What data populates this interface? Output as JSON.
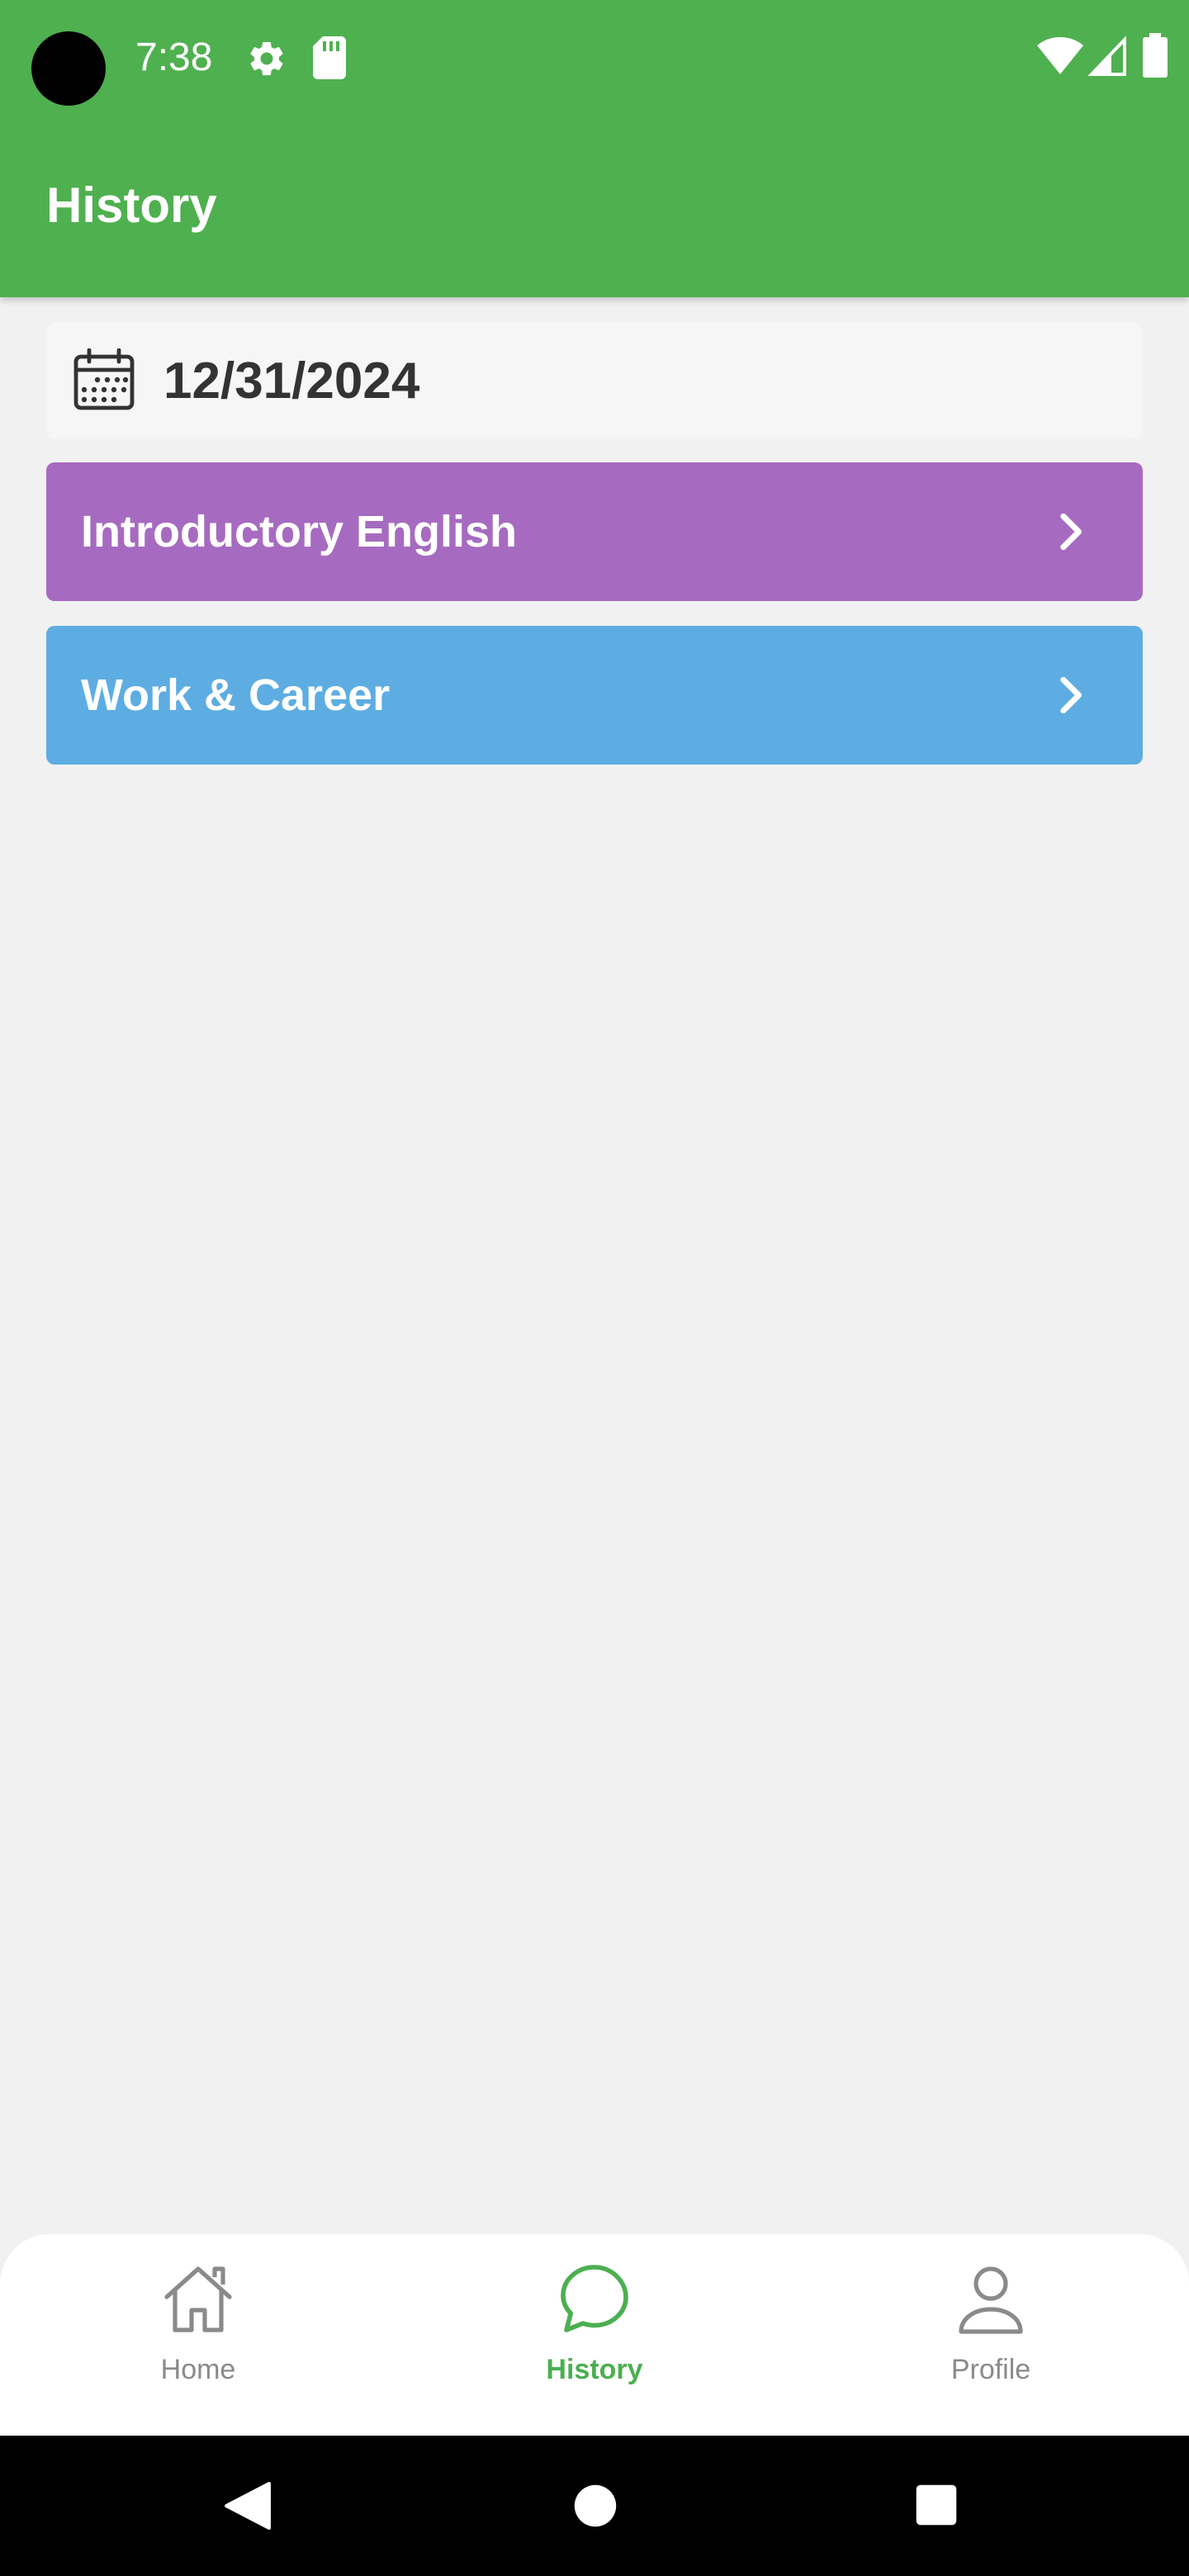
{
  "status_bar": {
    "time": "7:38",
    "icons": [
      "settings-icon",
      "sd-card-icon",
      "wifi-icon",
      "cell-signal-icon",
      "battery-icon"
    ]
  },
  "app_bar": {
    "title": "History"
  },
  "date_card": {
    "icon": "calendar-icon",
    "date": "12/31/2024"
  },
  "topics": [
    {
      "label": "Introductory English",
      "color": "#a66bc0",
      "icon": "chevron-right-icon"
    },
    {
      "label": "Work & Career",
      "color": "#5dade2",
      "icon": "chevron-right-icon"
    }
  ],
  "bottom_nav": {
    "items": [
      {
        "label": "Home",
        "icon": "home-icon",
        "active": false
      },
      {
        "label": "History",
        "icon": "chat-bubble-icon",
        "active": true
      },
      {
        "label": "Profile",
        "icon": "person-icon",
        "active": false
      }
    ]
  },
  "colors": {
    "header": "#4fb04f",
    "active_nav": "#4caf50",
    "inactive_nav": "#8a8a8a",
    "background": "#f1f1f1"
  }
}
